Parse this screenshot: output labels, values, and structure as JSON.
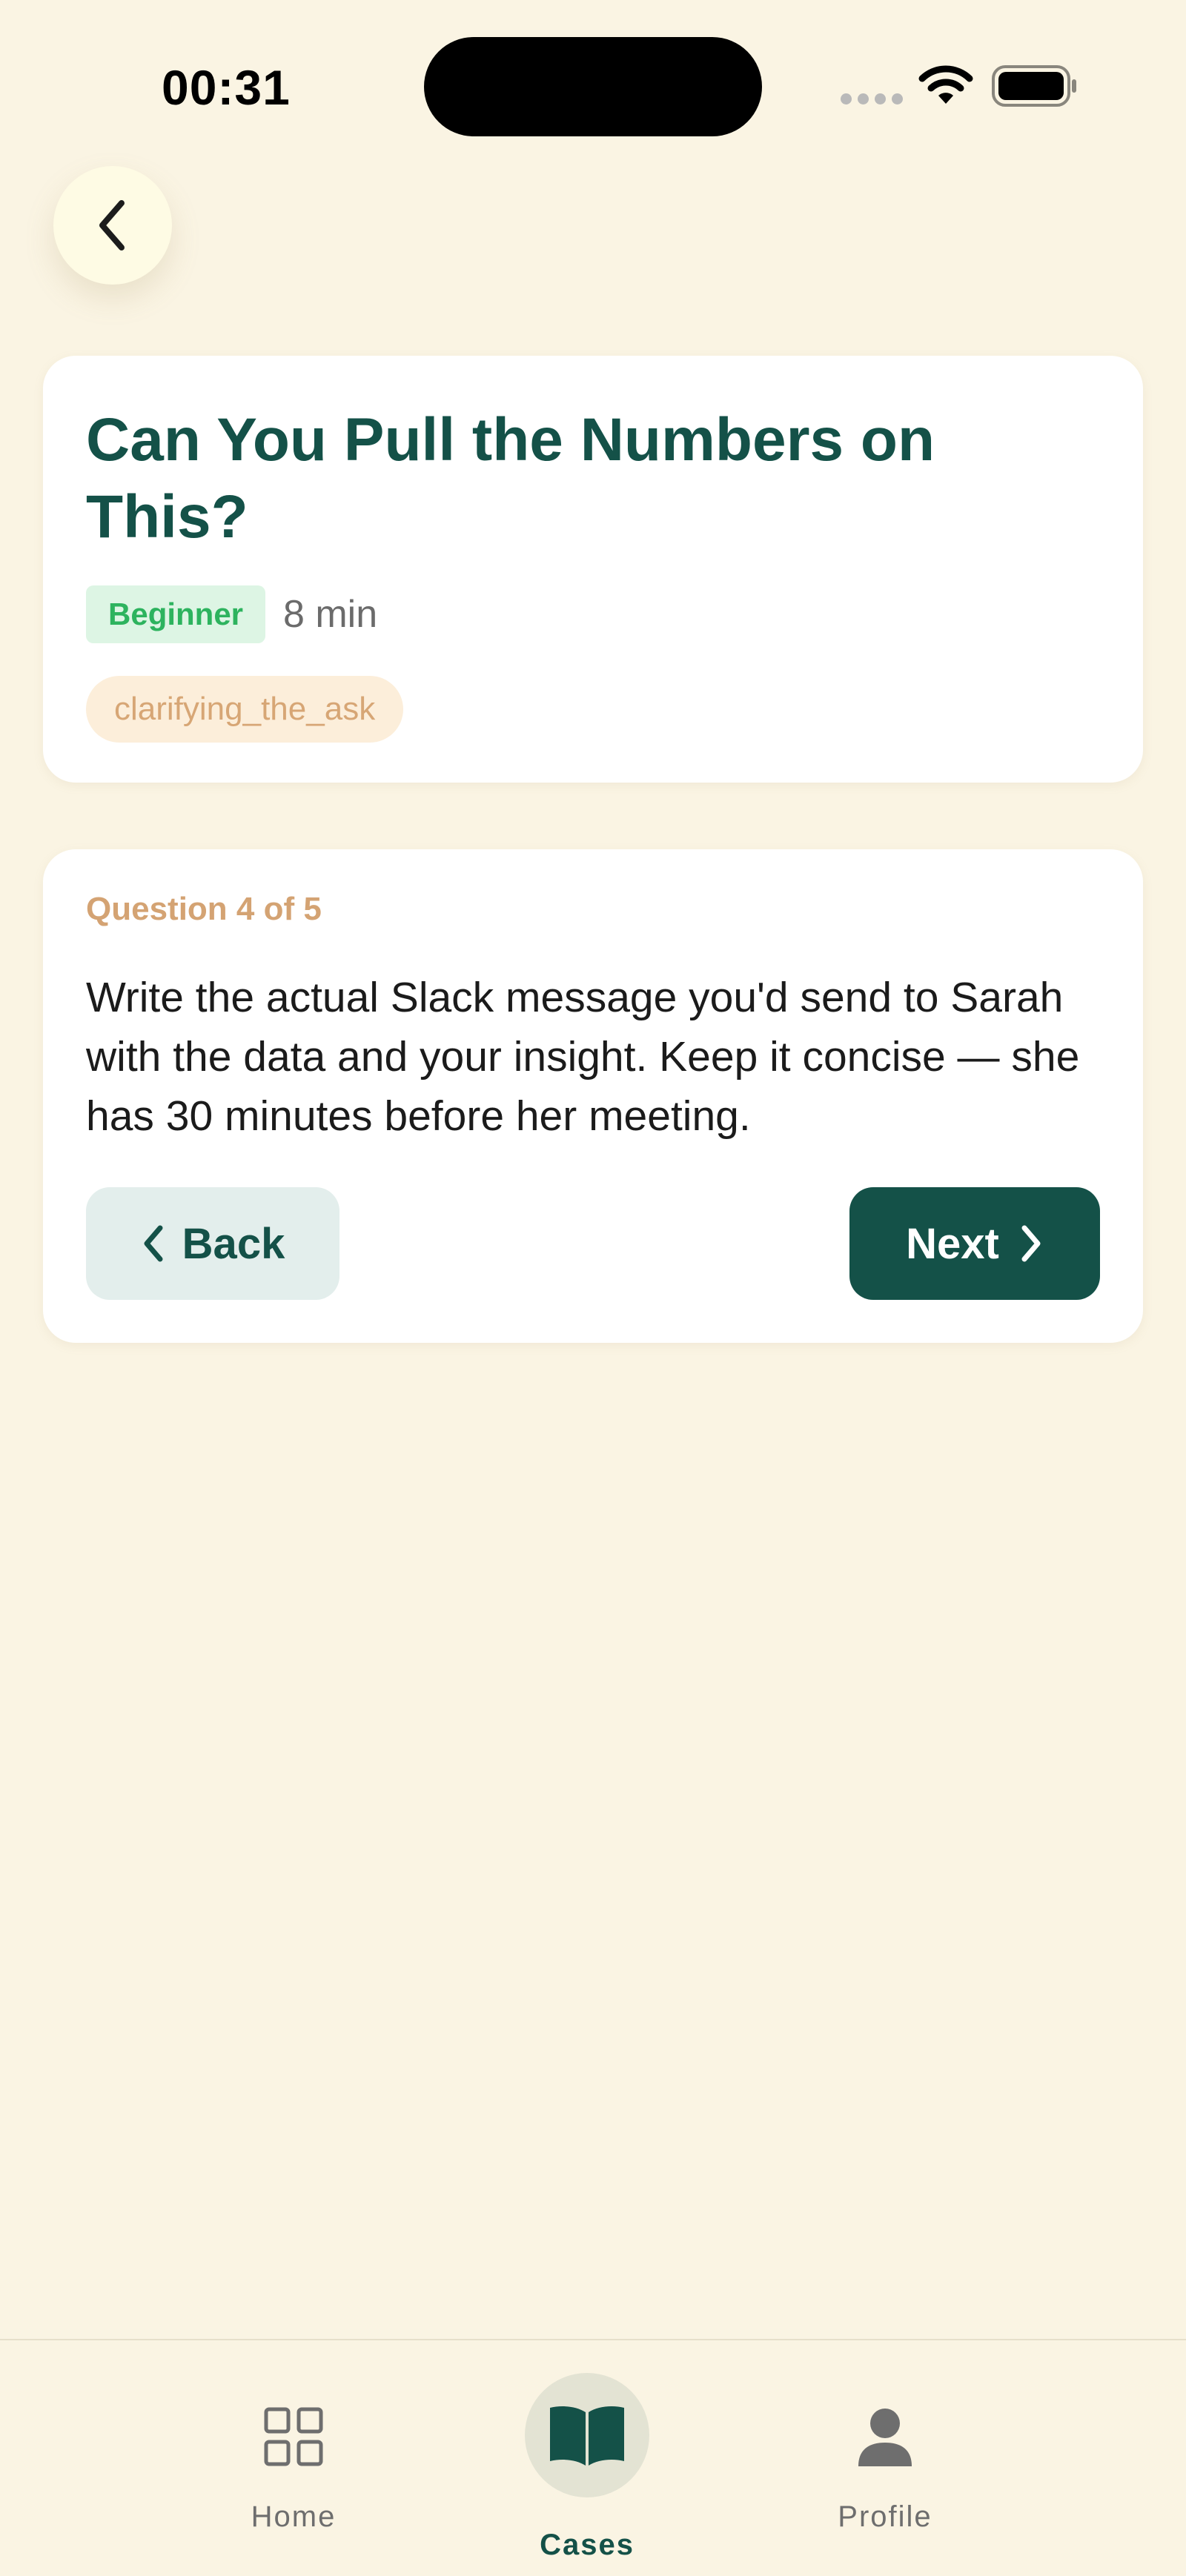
{
  "status_bar": {
    "time": "00:31"
  },
  "case": {
    "title": "Can You Pull the Numbers on This?",
    "difficulty": "Beginner",
    "duration": "8 min",
    "skill_tag": "clarifying_the_ask"
  },
  "question": {
    "counter": "Question 4 of 5",
    "text": "Write the actual Slack message you'd send to Sarah with the data and your insight. Keep it concise — she has 30 minutes before her meeting.",
    "back_label": "Back",
    "next_label": "Next"
  },
  "nav": {
    "items": [
      {
        "label": "Home",
        "icon": "grid-icon",
        "active": false
      },
      {
        "label": "Cases",
        "icon": "book-icon",
        "active": true
      },
      {
        "label": "Profile",
        "icon": "person-icon",
        "active": false
      }
    ]
  },
  "colors": {
    "background": "#FAF4E3",
    "primary": "#145148",
    "accent": "#D4A373",
    "badge_green": "#2DB35E"
  }
}
